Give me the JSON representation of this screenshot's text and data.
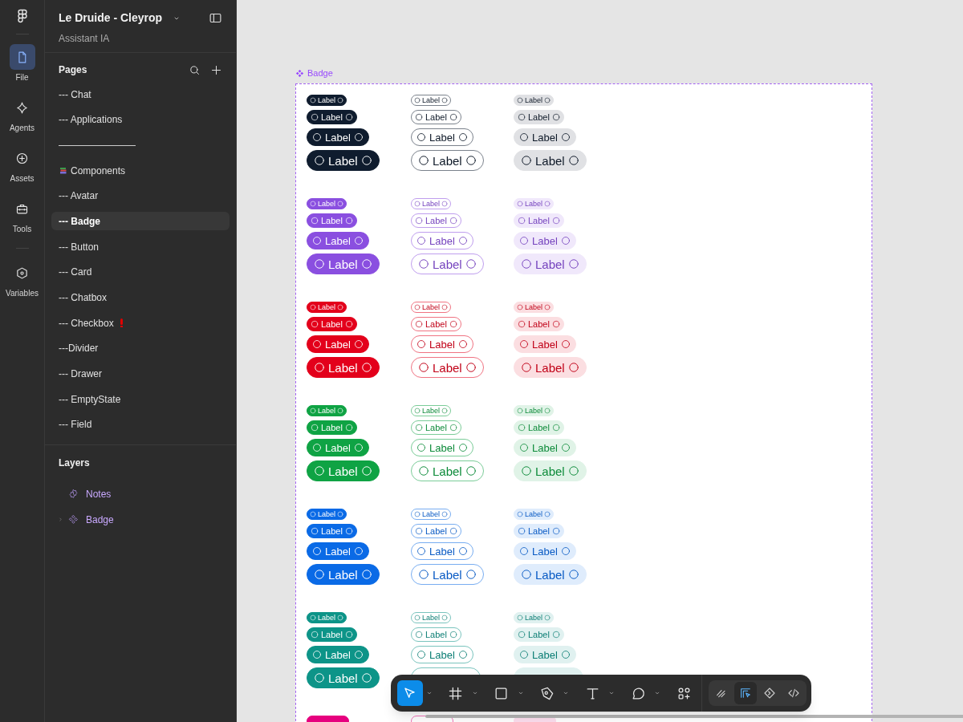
{
  "rail": [
    {
      "kind": "file",
      "label": "File",
      "selected": true
    },
    {
      "kind": "agents",
      "label": "Agents",
      "selected": false
    },
    {
      "kind": "assets",
      "label": "Assets",
      "selected": false
    },
    {
      "kind": "tools",
      "label": "Tools",
      "selected": false
    },
    {
      "kind": "variables",
      "label": "Variables",
      "selected": false
    }
  ],
  "file": {
    "title": "Le Druide - Cleyrop",
    "subtitle": "Assistant IA"
  },
  "pages": {
    "title": "Pages",
    "items": [
      {
        "label": "--- Chat",
        "selected": false
      },
      {
        "label": "--- Applications",
        "selected": false
      },
      {
        "label": "————————",
        "selected": false
      },
      {
        "label": "Components",
        "selected": false,
        "kind": "books"
      },
      {
        "label": "--- Avatar",
        "selected": false
      },
      {
        "label": "--- Badge",
        "selected": true
      },
      {
        "label": "--- Button",
        "selected": false
      },
      {
        "label": "--- Card",
        "selected": false
      },
      {
        "label": "--- Chatbox",
        "selected": false
      },
      {
        "label": "--- Checkbox",
        "selected": false,
        "kind": "warning"
      },
      {
        "label": "---Divider",
        "selected": false
      },
      {
        "label": "--- Drawer",
        "selected": false
      },
      {
        "label": "--- EmptyState",
        "selected": false
      },
      {
        "label": "--- Field",
        "selected": false
      }
    ]
  },
  "layers": {
    "title": "Layers",
    "items": [
      {
        "kind": "notes",
        "label": "Notes"
      },
      {
        "kind": "component",
        "label": "Badge",
        "expanded": false
      }
    ]
  },
  "frame": {
    "label": "Badge",
    "groups": [
      {
        "color": "#0f1c2e",
        "columns": [
          {
            "kind": "solid",
            "labels": [
              "Label",
              "Label",
              "Label",
              "Label"
            ]
          },
          {
            "kind": "outline",
            "labels": [
              "Label",
              "Label",
              "Label",
              "Label"
            ]
          },
          {
            "kind": "soft",
            "labels": [
              "Label",
              "Label",
              "Label",
              "Label"
            ]
          }
        ]
      },
      {
        "color": "#8a4fe0",
        "columns": [
          {
            "kind": "solid",
            "labels": [
              "Label",
              "Label",
              "Label",
              "Label"
            ]
          },
          {
            "kind": "outline",
            "labels": [
              "Label",
              "Label",
              "Label",
              "Label"
            ]
          },
          {
            "kind": "soft",
            "labels": [
              "Label",
              "Label",
              "Label",
              "Label"
            ]
          }
        ]
      },
      {
        "color": "#e3001b",
        "columns": [
          {
            "kind": "solid",
            "labels": [
              "Label",
              "Label",
              "Label",
              "Label"
            ]
          },
          {
            "kind": "outline",
            "labels": [
              "Label",
              "Label",
              "Label",
              "Label"
            ]
          },
          {
            "kind": "soft",
            "labels": [
              "Label",
              "Label",
              "Label",
              "Label"
            ]
          }
        ]
      },
      {
        "color": "#0fa344",
        "columns": [
          {
            "kind": "solid",
            "labels": [
              "Label",
              "Label",
              "Label",
              "Label"
            ]
          },
          {
            "kind": "outline",
            "labels": [
              "Label",
              "Label",
              "Label",
              "Label"
            ]
          },
          {
            "kind": "soft",
            "labels": [
              "Label",
              "Label",
              "Label",
              "Label"
            ]
          }
        ]
      },
      {
        "color": "#0a6ae6",
        "columns": [
          {
            "kind": "solid",
            "labels": [
              "Label",
              "Label",
              "Label",
              "Label"
            ]
          },
          {
            "kind": "outline",
            "labels": [
              "Label",
              "Label",
              "Label",
              "Label"
            ]
          },
          {
            "kind": "soft",
            "labels": [
              "Label",
              "Label",
              "Label",
              "Label"
            ]
          }
        ]
      },
      {
        "color": "#0d9488",
        "columns": [
          {
            "kind": "solid",
            "labels": [
              "Label",
              "Label",
              "Label",
              "Label"
            ]
          },
          {
            "kind": "outline",
            "labels": [
              "Label",
              "Label",
              "Label"
            ]
          },
          {
            "kind": "soft",
            "labels": [
              "Label",
              "Label",
              "Label"
            ]
          }
        ]
      },
      {
        "color": "#e6007e",
        "kind": "cut"
      }
    ]
  },
  "toolbar": {
    "tools": [
      {
        "kind": "move",
        "selected": true,
        "dropdown": true
      },
      {
        "kind": "frame",
        "selected": false,
        "dropdown": true
      },
      {
        "kind": "rectangle",
        "selected": false,
        "dropdown": true
      },
      {
        "kind": "pen",
        "selected": false,
        "dropdown": true
      },
      {
        "kind": "text",
        "selected": false,
        "dropdown": true
      },
      {
        "kind": "comment",
        "selected": false,
        "dropdown": true
      },
      {
        "kind": "actions",
        "selected": false,
        "dropdown": false
      }
    ],
    "modes": [
      {
        "kind": "draw",
        "selected": false
      },
      {
        "kind": "design",
        "selected": true
      },
      {
        "kind": "prototype",
        "selected": false
      },
      {
        "kind": "dev",
        "selected": false
      }
    ]
  }
}
